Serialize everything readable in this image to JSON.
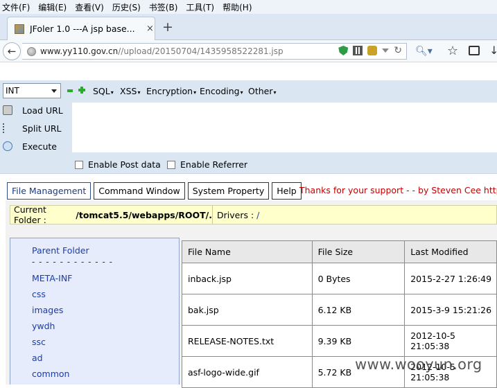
{
  "menubar": [
    "文件(F)",
    "编辑(E)",
    "查看(V)",
    "历史(S)",
    "书签(B)",
    "工具(T)",
    "帮助(H)"
  ],
  "tab": {
    "title": "JFoler 1.0 ---A jsp base...",
    "close": "×",
    "new": "+"
  },
  "url": {
    "host": "www.yy110.gov.cn",
    "path": "//upload/20150704/1435958522281.jsp"
  },
  "hackbar": {
    "select_value": "INT",
    "menus": [
      "SQL",
      "XSS",
      "Encryption",
      "Encoding",
      "Other"
    ],
    "actions": [
      "Load URL",
      "Split URL",
      "Execute"
    ],
    "checks": [
      "Enable Post data",
      "Enable Referrer"
    ]
  },
  "nav": {
    "tabs": [
      "File Management",
      "Command Window",
      "System Property",
      "Help"
    ],
    "thanks": "Thanks for your support - - by Steven Cee http://"
  },
  "folder": {
    "label": "Current Folder :",
    "path": "/tomcat5.5/webapps/ROOT/.",
    "drivers_label": "Drivers :",
    "drive": "/"
  },
  "tree": {
    "parent": "Parent Folder",
    "separator": "- - - - - - - - - - - -",
    "items": [
      "META-INF",
      "css",
      "images",
      "ywdh",
      "ssc",
      "ad",
      "common"
    ]
  },
  "files": {
    "headers": [
      "File Name",
      "File Size",
      "Last Modified"
    ],
    "rows": [
      [
        "inback.jsp",
        "0 Bytes",
        "2015-2-27 1:26:49"
      ],
      [
        "bak.jsp",
        "6.12 KB",
        "2015-3-9 15:21:26"
      ],
      [
        "RELEASE-NOTES.txt",
        "9.39 KB",
        "2012-10-5 21:05:38"
      ],
      [
        "asf-logo-wide.gif",
        "5.72 KB",
        "2012-10-5 21:05:38"
      ]
    ]
  },
  "watermark": "www.wooyun.org"
}
